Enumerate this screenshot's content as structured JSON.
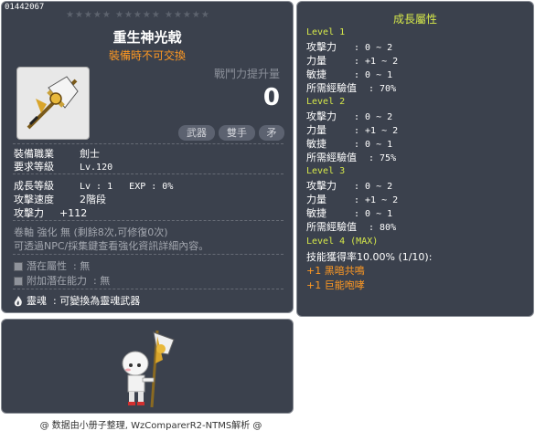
{
  "item": {
    "id": "01442067",
    "stars": "★★★★★ ★★★★★ ★★★★★",
    "name": "重生神光戟",
    "subtitle": "裝備時不可交換",
    "power_label": "戰鬥力提升量",
    "power_value": "0",
    "tags": [
      "武器",
      "雙手",
      "矛"
    ],
    "stats": [
      {
        "label": "裝備職業",
        "value": "劍士"
      },
      {
        "label": "要求等級",
        "value": "Lv.120"
      }
    ],
    "growth": {
      "label": "成長等級",
      "value": "Lv : 1   EXP : 0%"
    },
    "attack_speed": {
      "label": "攻擊速度",
      "value": "2階段"
    },
    "attack": {
      "label": "攻擊力",
      "value": "+112"
    },
    "scroll_line": "卷軸 強化 無 (剩餘8次,可修復0次)",
    "info_line": "可透過NPC/採集鍵查看強化資訊詳細內容。",
    "potential": {
      "label": "潛在屬性",
      "value": ": 無"
    },
    "bonus_potential": {
      "label": "附加潛在能力",
      "value": ": 無"
    },
    "soul": {
      "label": "靈魂",
      "value": ": 可變換為靈魂武器"
    }
  },
  "growth_panel": {
    "title": "成長屬性",
    "levels": [
      {
        "level": "Level 1",
        "rows": [
          {
            "label": "攻擊力",
            "value": ": 0 ~ 2"
          },
          {
            "label": "力量",
            "value": ": +1 ~ 2"
          },
          {
            "label": "敏捷",
            "value": ": 0 ~ 1"
          },
          {
            "label": "所需經驗值",
            "value": ": 70%"
          }
        ]
      },
      {
        "level": "Level 2",
        "rows": [
          {
            "label": "攻擊力",
            "value": ": 0 ~ 2"
          },
          {
            "label": "力量",
            "value": ": +1 ~ 2"
          },
          {
            "label": "敏捷",
            "value": ": 0 ~ 1"
          },
          {
            "label": "所需經驗值",
            "value": ": 75%"
          }
        ]
      },
      {
        "level": "Level 3",
        "rows": [
          {
            "label": "攻擊力",
            "value": ": 0 ~ 2"
          },
          {
            "label": "力量",
            "value": ": +1 ~ 2"
          },
          {
            "label": "敏捷",
            "value": ": 0 ~ 1"
          },
          {
            "label": "所需經驗值",
            "value": ": 80%"
          }
        ]
      },
      {
        "level": "Level 4 (MAX)",
        "rows": [
          {
            "label": "",
            "value": "技能獲得率10.00% (1/10):"
          }
        ]
      }
    ],
    "skills": [
      "+1 黑暗共鳴",
      "+1 巨能咆哮"
    ]
  },
  "footer": "@ 数据由小册子整理, WzComparerR2-NTMS解析 @",
  "colors": {
    "panel_bg": "#3b414d",
    "panel_border": "#878b93",
    "accent_orange": "#ff9922",
    "level_yellow": "#d6e84a",
    "muted_text": "#a3a7af"
  },
  "icons": [
    "halberd-icon",
    "character-sprite",
    "potential-square-icon",
    "soul-flame-icon"
  ]
}
